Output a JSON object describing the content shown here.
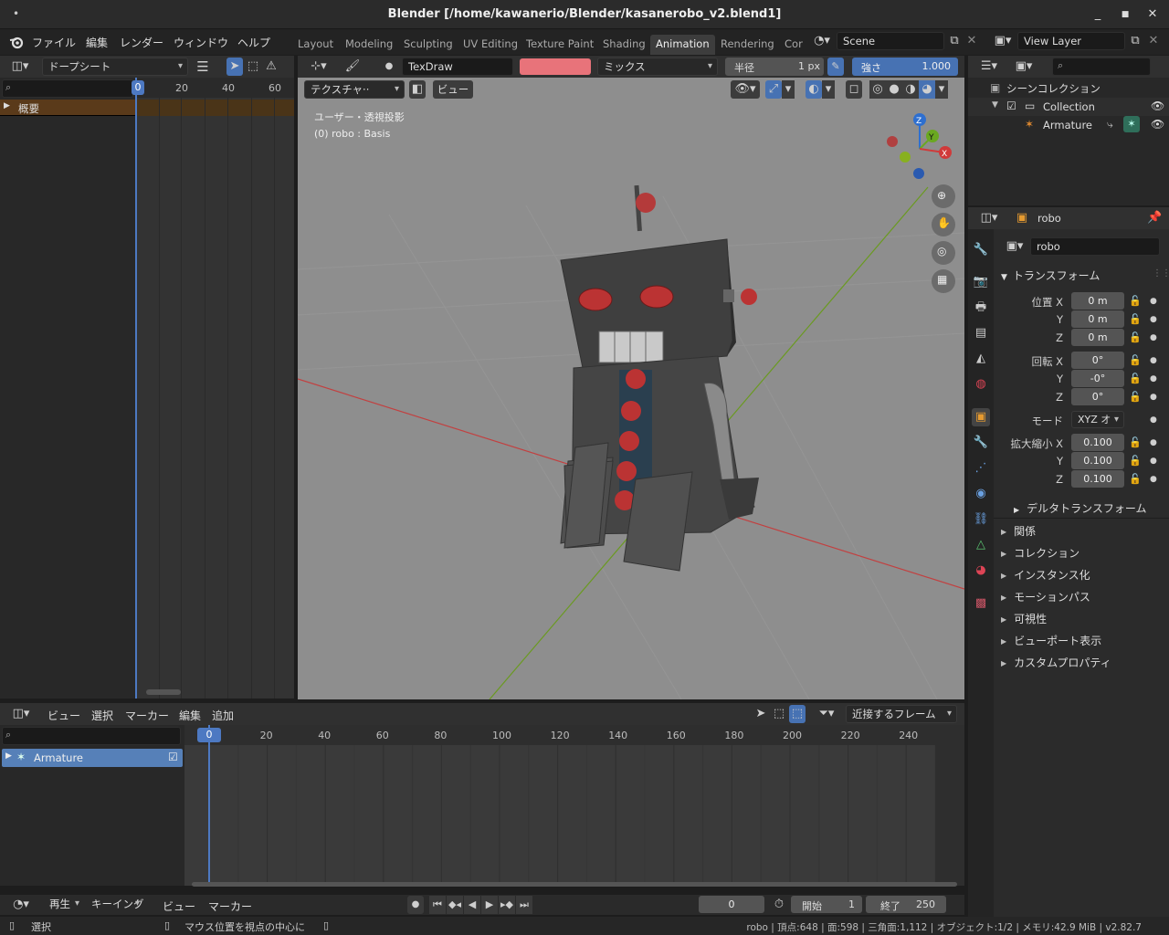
{
  "window": {
    "title": "Blender [/home/kawanerio/Blender/kasanerobo_v2.blend1]",
    "minimize": "_",
    "maximize": "■",
    "close": "✕"
  },
  "menu": [
    "ファイル",
    "編集",
    "レンダー",
    "ウィンドウ",
    "ヘルプ"
  ],
  "workspaces": [
    {
      "label": "Layout"
    },
    {
      "label": "Modeling"
    },
    {
      "label": "Sculpting"
    },
    {
      "label": "UV Editing"
    },
    {
      "label": "Texture Paint"
    },
    {
      "label": "Shading"
    },
    {
      "label": "Animation"
    },
    {
      "label": "Rendering"
    },
    {
      "label": "Cor"
    }
  ],
  "scene": {
    "name": "Scene",
    "view_layer": "View Layer"
  },
  "dopesheet_top": {
    "mode": "ドープシート",
    "ticks": [
      "0",
      "20",
      "40",
      "60"
    ],
    "summary": "概要"
  },
  "viewport": {
    "brush": "TexDraw",
    "blend": "ミックス",
    "radius_label": "半径",
    "radius_value": "1 px",
    "strength_label": "強さ",
    "strength_value": "1.000",
    "mode": "テクスチャ··",
    "view_menu": "ビュー",
    "info_line1": "ユーザー・透視投影",
    "info_line2": "(0) robo : Basis",
    "brush_color": "#e8737a",
    "gizmo": {
      "z": "Z",
      "y": "Y",
      "x": "X"
    }
  },
  "outliner": {
    "root": "シーンコレクション",
    "collection": "Collection",
    "armature": "Armature"
  },
  "properties": {
    "object_name": "robo",
    "data_name": "robo",
    "transform_title": "トランスフォーム",
    "location": {
      "x_label": "位置 X",
      "y_label": "Y",
      "z_label": "Z",
      "x": "0 m",
      "y": "0 m",
      "z": "0 m"
    },
    "rotation": {
      "x_label": "回転 X",
      "y_label": "Y",
      "z_label": "Z",
      "x": "0°",
      "y": "-0°",
      "z": "0°"
    },
    "mode_label": "モード",
    "mode_value": "XYZ オ",
    "scale": {
      "x_label": "拡大縮小 X",
      "y_label": "Y",
      "z_label": "Z",
      "x": "0.100",
      "y": "0.100",
      "z": "0.100"
    },
    "delta": "デルタトランスフォーム",
    "sections": [
      "関係",
      "コレクション",
      "インスタンス化",
      "モーションパス",
      "可視性",
      "ビューポート表示",
      "カスタムプロパティ"
    ]
  },
  "timeline": {
    "menus": [
      "ビュー",
      "選択",
      "マーカー",
      "編集",
      "追加"
    ],
    "snap": "近接するフレーム",
    "channel": "Armature",
    "ticks": [
      "0",
      "20",
      "40",
      "60",
      "80",
      "100",
      "120",
      "140",
      "160",
      "180",
      "200",
      "220",
      "240"
    ],
    "current_frame": "0"
  },
  "playback": {
    "play": "再生",
    "keying": "キーイング",
    "view": "ビュー",
    "marker": "マーカー",
    "frame": "0",
    "start_label": "開始",
    "start": "1",
    "end_label": "終了",
    "end": "250"
  },
  "status": {
    "left": "選択",
    "middle": "マウス位置を視点の中心に",
    "right": "robo | 頂点:648 | 面:598 | 三角面:1,112 | オブジェクト:1/2 | メモリ:42.9 MiB | v2.82.7"
  }
}
